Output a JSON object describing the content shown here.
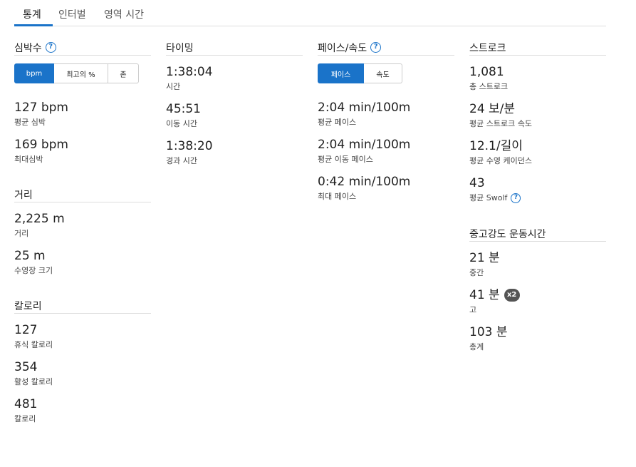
{
  "tabs": [
    "통계",
    "인터벌",
    "영역 시간"
  ],
  "heart_rate": {
    "title": "심박수",
    "toggle": [
      "bpm",
      "최고의 %",
      "존"
    ],
    "stats": [
      {
        "value": "127 bpm",
        "label": "평균 심박"
      },
      {
        "value": "169 bpm",
        "label": "최대심박"
      }
    ]
  },
  "distance": {
    "title": "거리",
    "stats": [
      {
        "value": "2,225 m",
        "label": "거리"
      },
      {
        "value": "25 m",
        "label": "수영장 크기"
      }
    ]
  },
  "calories": {
    "title": "칼로리",
    "stats": [
      {
        "value": "127",
        "label": "휴식 칼로리"
      },
      {
        "value": "354",
        "label": "활성 칼로리"
      },
      {
        "value": "481",
        "label": "칼로리"
      }
    ]
  },
  "timing": {
    "title": "타이밍",
    "stats": [
      {
        "value": "1:38:04",
        "label": "시간"
      },
      {
        "value": "45:51",
        "label": "이동 시간"
      },
      {
        "value": "1:38:20",
        "label": "경과 시간"
      }
    ]
  },
  "pace": {
    "title": "페이스/속도",
    "toggle": [
      "페이스",
      "속도"
    ],
    "stats": [
      {
        "value": "2:04 min/100m",
        "label": "평균 페이스"
      },
      {
        "value": "2:04 min/100m",
        "label": "평균 이동 페이스"
      },
      {
        "value": "0:42 min/100m",
        "label": "최대 페이스"
      }
    ]
  },
  "stroke": {
    "title": "스트로크",
    "stats": [
      {
        "value": "1,081",
        "label": "총 스트로크"
      },
      {
        "value": "24 보/분",
        "label": "평균 스트로크 속도"
      },
      {
        "value": "12.1/길이",
        "label": "평균 수영 케이던스"
      },
      {
        "value": "43",
        "label": "평균 Swolf"
      }
    ]
  },
  "intensity": {
    "title": "중고강도 운동시간",
    "badge": "x2",
    "stats": [
      {
        "value": "21 분",
        "label": "중간"
      },
      {
        "value": "41 분",
        "label": "고"
      },
      {
        "value": "103 분",
        "label": "총계"
      }
    ]
  },
  "help_icon": "?",
  "colors": {
    "accent": "#1a73c9",
    "badge": "#555555",
    "divider": "#dddddd"
  }
}
